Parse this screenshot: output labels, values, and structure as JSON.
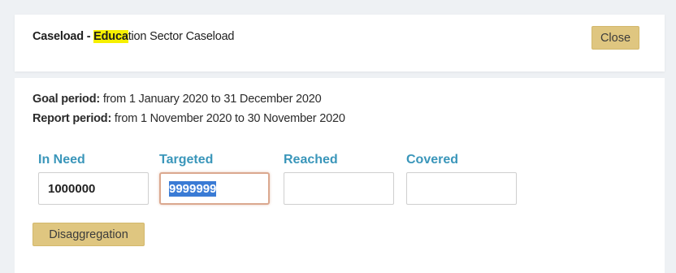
{
  "header": {
    "title_prefix": "Caseload - ",
    "title_highlight": "Educa",
    "title_suffix": "tion Sector Caseload",
    "close_label": "Close"
  },
  "periods": {
    "goal_label": "Goal period:",
    "goal_value": " from 1 January 2020 to 31 December 2020",
    "report_label": "Report period:",
    "report_value": " from 1 November 2020 to 30 November 2020"
  },
  "fields": [
    {
      "label": "In Need",
      "value": "1000000"
    },
    {
      "label": "Targeted",
      "value": "9999999"
    },
    {
      "label": "Reached",
      "value": ""
    },
    {
      "label": "Covered",
      "value": ""
    }
  ],
  "disaggregation_label": "Disaggregation",
  "colors": {
    "accent_label": "#3a96ba",
    "button_bg": "#dfc680",
    "highlight": "#f6f000",
    "focus_border": "#dba88f",
    "selection": "#3a7bd5"
  }
}
